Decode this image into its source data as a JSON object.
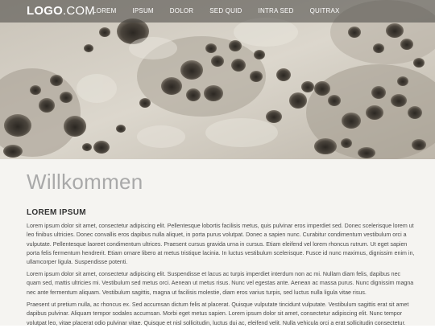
{
  "header": {
    "logo_bold": "LOGO",
    "logo_rest": ".COM",
    "menu": [
      "LOREM",
      "IPSUM",
      "DOLOR",
      "SED QUID",
      "INTRA SED",
      "QUITRAX"
    ]
  },
  "main": {
    "title": "Willkommen",
    "subtitle": "LOREM IPSUM",
    "paragraphs": [
      "Lorem ipsum dolor sit amet, consectetur adipiscing elit. Pellentesque lobortis facilisis metus, quis pulvinar eros imperdiet sed. Donec scelerisque lorem ut leo finibus ultricies. Donec convallis eros dapibus nulla aliquet, in porta purus volutpat. Donec a sapien nunc. Curabitur condimentum vestibulum orci a vulputate. Pellentesque laoreet condimentum ultrices. Praesent cursus gravida urna in cursus. Etiam eleifend vel lorem rhoncus rutrum. Ut eget sapien porta felis fermentum hendrerit. Etiam ornare libero at metus tristique lacinia. In luctus vestibulum scelerisque. Fusce id nunc maximus, dignissim enim in, ullamcorper ligula. Suspendisse potenti.",
      "Lorem ipsum dolor sit amet, consectetur adipiscing elit. Suspendisse et lacus ac turpis imperdiet interdum non ac mi. Nullam diam felis, dapibus nec quam sed, mattis ultricies mi. Vestibulum sed metus orci. Aenean ut metus risus. Nunc vel egestas ante. Aenean ac massa purus. Nunc dignissim magna nec ante fermentum aliquam. Vestibulum sagittis, magna ut facilisis molestie, diam eros varius turpis, sed luctus nulla ligula vitae risus.",
      "Praesent ut pretium nulla, ac rhoncus ex. Sed accumsan dictum felis at placerat. Quisque vulputate tincidunt vulputate. Vestibulum sagittis erat sit amet dapibus pulvinar. Aliquam tempor sodales accumsan. Morbi eget metus sapien. Lorem ipsum dolor sit amet, consectetur adipiscing elit. Nunc tempor volutpat leo, vitae placerat odio pulvinar vitae. Quisque et nisl sollicitudin, luctus dui ac, eleifend velit. Nulla vehicula orci a erat sollicitudin consectetur."
    ]
  },
  "colors": {
    "nav_overlay": "#46443f",
    "rock_light": "#d9d4ca",
    "rock_shadow": "#3a352e",
    "title_gray": "#a9a9a9",
    "body_bg": "#f5f4f1"
  },
  "icons": {
    "hero": "tafoni-rock-photo"
  }
}
